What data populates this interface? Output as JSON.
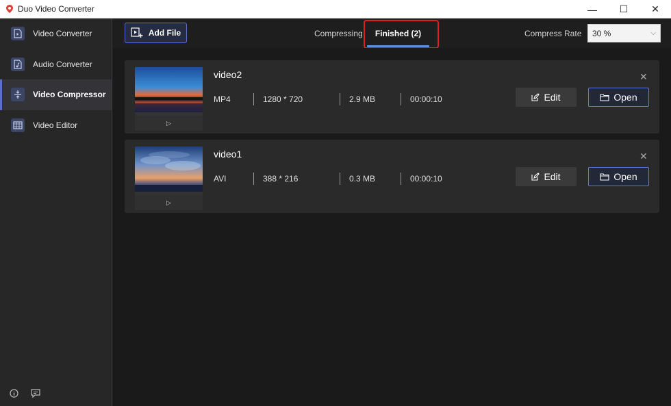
{
  "window": {
    "title": "Duo Video Converter",
    "controls": {
      "minimize": "—",
      "maximize": "☐",
      "close": "✕"
    }
  },
  "sidebar": {
    "items": [
      {
        "label": "Video Converter",
        "icon": "video-file-icon",
        "active": false
      },
      {
        "label": "Audio Converter",
        "icon": "audio-file-icon",
        "active": false
      },
      {
        "label": "Video Compressor",
        "icon": "compress-icon",
        "active": true
      },
      {
        "label": "Video Editor",
        "icon": "film-edit-icon",
        "active": false
      }
    ],
    "bottom_icons": [
      "info-icon",
      "feedback-icon"
    ]
  },
  "toolbar": {
    "add_file_label": "Add File",
    "tabs": [
      {
        "label": "Compressing",
        "active": false
      },
      {
        "label": "Finished (2)",
        "active": true
      }
    ],
    "compress_rate_label": "Compress Rate",
    "compress_rate_value": "30 %"
  },
  "files": [
    {
      "name": "video2",
      "format": "MP4",
      "resolution": "1280 * 720",
      "size": "2.9 MB",
      "duration": "00:00:10",
      "edit_label": "Edit",
      "open_label": "Open"
    },
    {
      "name": "video1",
      "format": "AVI",
      "resolution": "388 * 216",
      "size": "0.3 MB",
      "duration": "00:00:10",
      "edit_label": "Edit",
      "open_label": "Open"
    }
  ],
  "colors": {
    "accent": "#5b6fc8",
    "tab_underline": "#5b8ddc",
    "highlight": "#e02020",
    "background": "#1a1a1a",
    "card": "#2a2a2a"
  }
}
